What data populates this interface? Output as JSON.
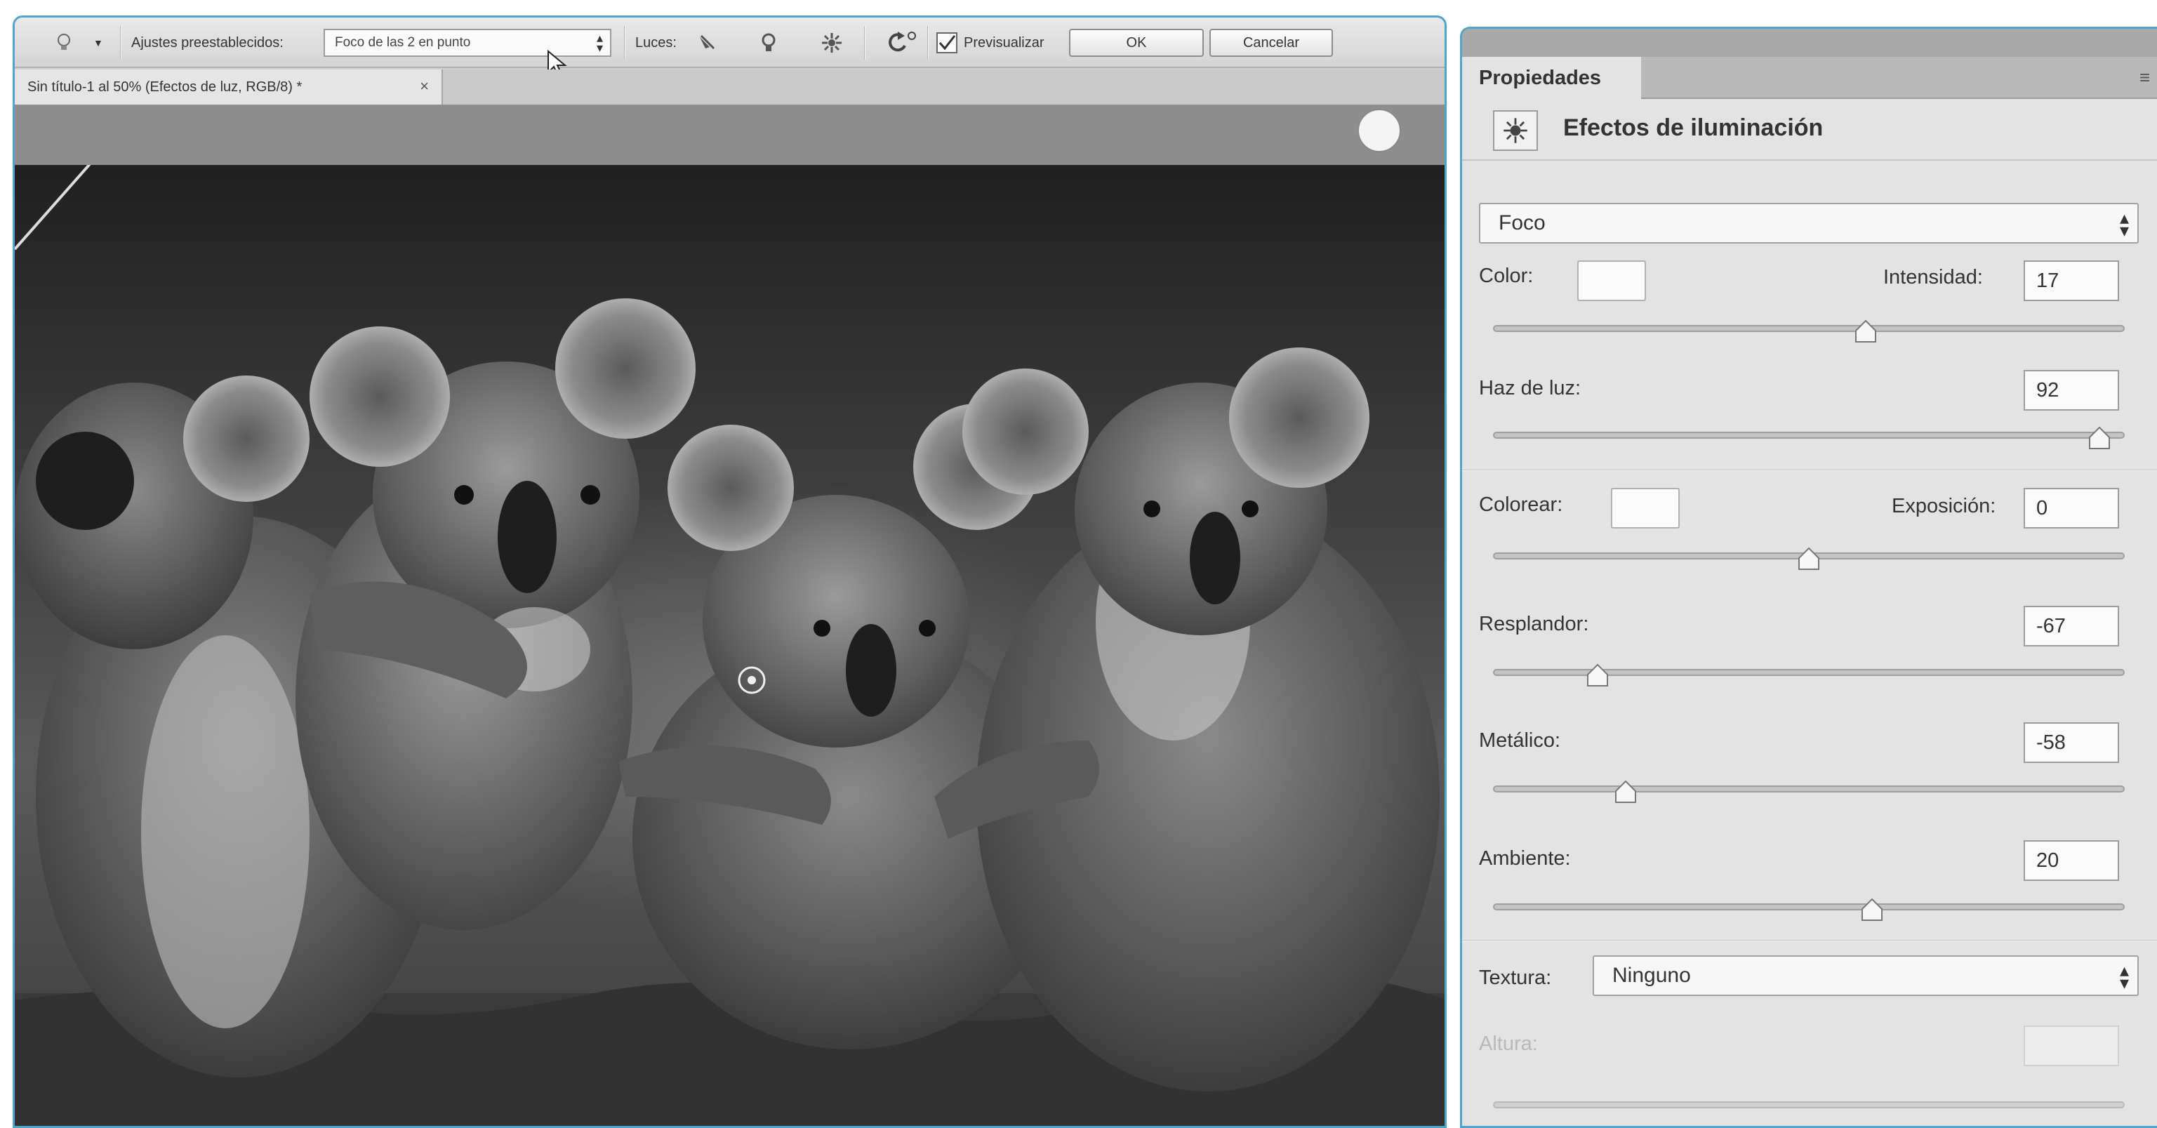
{
  "options_bar": {
    "presets_label": "Ajustes preestablecidos:",
    "preset_value": "Foco de las 2 en punto",
    "lights_label": "Luces:",
    "preview_label": "Previsualizar",
    "preview_checked": true,
    "ok_label": "OK",
    "cancel_label": "Cancelar"
  },
  "document": {
    "tab_title": "Sin título-1 al 50% (Efectos de luz, RGB/8) *",
    "close_label": "×"
  },
  "properties": {
    "tab_label": "Propiedades",
    "heading": "Efectos de iluminación",
    "light_type": "Foco",
    "color_label": "Color:",
    "intensity_label": "Intensidad:",
    "intensity_value": "17",
    "hotspot_label": "Haz de luz:",
    "hotspot_value": "92",
    "colorize_label": "Colorear:",
    "exposure_label": "Exposición:",
    "exposure_value": "0",
    "gloss_label": "Resplandor:",
    "gloss_value": "-67",
    "metallic_label": "Metálico:",
    "metallic_value": "-58",
    "ambience_label": "Ambiente:",
    "ambience_value": "20",
    "texture_label": "Textura:",
    "texture_value": "Ninguno",
    "height_label": "Altura:"
  },
  "sliders": {
    "intensity": 0.59,
    "hotspot": 0.96,
    "exposure": 0.5,
    "gloss": 0.165,
    "metallic": 0.21,
    "ambience": 0.6
  },
  "icons": [
    "light-bulb-icon",
    "chevron-down-icon",
    "add-spot-light-icon",
    "add-point-light-icon",
    "add-infinite-light-icon",
    "reset-light-icon",
    "checkbox-icon",
    "close-icon",
    "lighting-effects-icon",
    "panel-menu-icon"
  ]
}
